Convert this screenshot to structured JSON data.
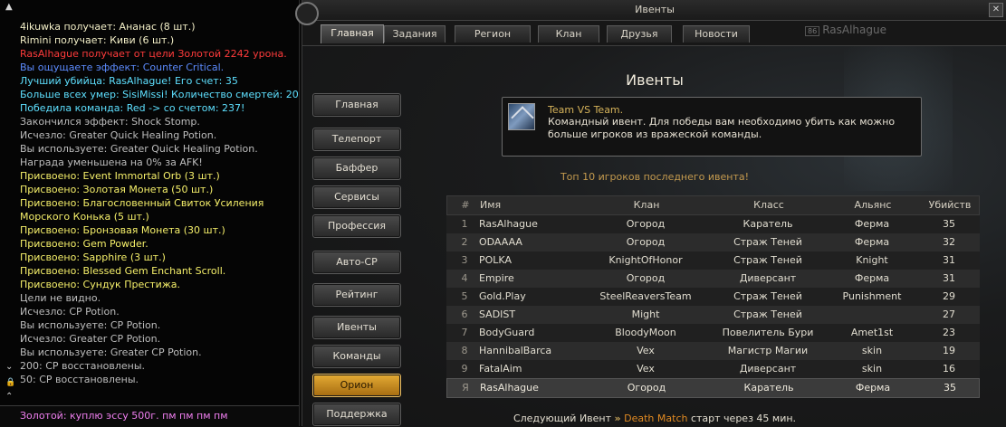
{
  "chat": {
    "lines": [
      {
        "text": "4ikuwka получает: Ананас (8 шт.)",
        "color": "#f4f0c8"
      },
      {
        "text": "Rimini получает: Киви (6 шт.)",
        "color": "#f4f0c8"
      },
      {
        "text": "RasAlhague получает от цели Золотой 2242 урона.",
        "color": "#ff3b3b"
      },
      {
        "text": "Вы ощущаете эффект: Counter Critical.",
        "color": "#5d8cff"
      },
      {
        "text": "Лучший убийца: RasAlhague! Его счет: 35",
        "color": "#5ee0ff"
      },
      {
        "text": "Больше всех умер: SisiMissi! Количество смертей: 20",
        "color": "#5ee0ff"
      },
      {
        "text": "Победила команда: Red -> со счетом: 237!",
        "color": "#5ee0ff"
      },
      {
        "text": "Закончился эффект: Shock Stomp.",
        "color": "#bdbdbd"
      },
      {
        "text": "Исчезло: Greater Quick Healing Potion.",
        "color": "#bdbdbd"
      },
      {
        "text": "Вы используете: Greater Quick Healing Potion.",
        "color": "#bdbdbd"
      },
      {
        "text": "Награда уменьшена на 0% за AFK!",
        "color": "#bdbdbd"
      },
      {
        "text": "Присвоено: Event Immortal Orb (3 шт.)",
        "color": "#f6f06a"
      },
      {
        "text": "Присвоено: Золотая Монета (50 шт.)",
        "color": "#f6f06a"
      },
      {
        "text": "Присвоено: Благословенный Свиток Усиления Морского Конька (5 шт.)",
        "color": "#f6f06a",
        "wrap": true
      },
      {
        "text": "Присвоено: Бронзовая Монета (30 шт.)",
        "color": "#f6f06a"
      },
      {
        "text": "Присвоено: Gem Powder.",
        "color": "#f6f06a"
      },
      {
        "text": "Присвоено: Sapphire (3 шт.)",
        "color": "#f6f06a"
      },
      {
        "text": "Присвоено: Blessed Gem Enchant Scroll.",
        "color": "#f6f06a"
      },
      {
        "text": "Присвоено: Сундук Престижа.",
        "color": "#f6f06a"
      },
      {
        "text": "Цели не видно.",
        "color": "#bdbdbd"
      },
      {
        "text": "Исчезло: CP Potion.",
        "color": "#bdbdbd"
      },
      {
        "text": "Вы используете: CP Potion.",
        "color": "#bdbdbd"
      },
      {
        "text": "Исчезло: Greater CP Potion.",
        "color": "#bdbdbd"
      },
      {
        "text": "Вы используете: Greater CP Potion.",
        "color": "#bdbdbd"
      },
      {
        "text": "200: CP восстановлены.",
        "color": "#bdbdbd"
      },
      {
        "text": "50: CP восстановлены.",
        "color": "#bdbdbd"
      }
    ],
    "input_text": "Золотой: куплю эссу 500г. пм пм пм пм"
  },
  "window": {
    "title": "Ивенты",
    "tabs": [
      "Главная",
      "Задания",
      "Регион",
      "Клан",
      "Друзья",
      "Новости"
    ],
    "active_tab": 0,
    "player_level": "86",
    "player_name": "RasAlhague"
  },
  "sidebar": {
    "buttons": [
      "Главная",
      "Телепорт",
      "Баффер",
      "Сервисы",
      "Профессия",
      "Авто-CP",
      "Рейтинг",
      "Ивенты",
      "Команды",
      "Орион",
      "Поддержка"
    ],
    "active": 9
  },
  "main": {
    "title": "Ивенты",
    "event_name": "Team VS Team.",
    "event_desc": "Командный ивент. Для победы вам необходимо убить как можно больше игроков из вражеской команды.",
    "top_caption": "Топ 10 игроков последнего ивента!",
    "table": {
      "headers": [
        "#",
        "Имя",
        "Клан",
        "Класс",
        "Альянс",
        "Убийств"
      ],
      "rows": [
        [
          "1",
          "RasAlhague",
          "Огород",
          "Каратель",
          "Ферма",
          "35"
        ],
        [
          "2",
          "ODAAAA",
          "Огород",
          "Страж Теней",
          "Ферма",
          "32"
        ],
        [
          "3",
          "POLKA",
          "KnightOfHonor",
          "Страж Теней",
          "Knight",
          "31"
        ],
        [
          "4",
          "Empire",
          "Огород",
          "Диверсант",
          "Ферма",
          "31"
        ],
        [
          "5",
          "Gold.Play",
          "SteelReaversTeam",
          "Страж Теней",
          "Punishment",
          "29"
        ],
        [
          "6",
          "SADIST",
          "Might",
          "Страж Теней",
          "",
          "27"
        ],
        [
          "7",
          "BodyGuard",
          "BloodyMoon",
          "Повелитель Бури",
          "Amet1st",
          "23"
        ],
        [
          "8",
          "HannibalBarca",
          "Vex",
          "Магистр Магии",
          "skin",
          "19"
        ],
        [
          "9",
          "FatalAim",
          "Vex",
          "Диверсант",
          "skin",
          "16"
        ]
      ],
      "self_row": [
        "Я",
        "RasAlhague",
        "Огород",
        "Каратель",
        "Ферма",
        "35"
      ]
    },
    "next_event": {
      "prefix": "Следующий Ивент",
      "arrows": "»",
      "name": "Death Match",
      "suffix": "старт через 45 мин."
    }
  }
}
